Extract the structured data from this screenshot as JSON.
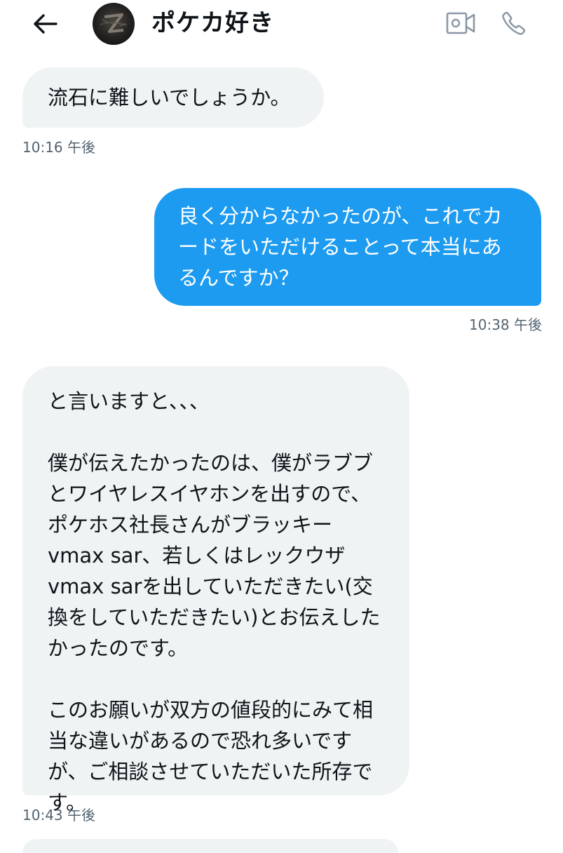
{
  "header": {
    "title": "ポケカ好き",
    "icons": {
      "back": "back-arrow-icon",
      "avatar": "avatar",
      "video": "video-call-icon",
      "phone": "phone-icon"
    }
  },
  "messages": [
    {
      "direction": "received",
      "text": "流石に難しいでしょうか。",
      "time": "10:16 午後"
    },
    {
      "direction": "sent",
      "text": "良く分からなかったのが、これでカードをいただけることって本当にあるんですか？",
      "time": "10:38 午後"
    },
    {
      "direction": "received",
      "text": "と言いますと、、、\n\n僕が伝えたかったのは、僕がラブブとワイヤレスイヤホンを出すので、ポケホス社長さんがブラッキーvmax sar、若しくはレックウザvmax sarを出していただきたい(交換をしていただきたい)とお伝えしたかったのです。\n\nこのお願いが双方の値段的にみて相当な違いがあるので恐れ多いですが、ご相談させていただいた所存です。",
      "time": "10:43 午後"
    }
  ],
  "colors": {
    "sent_bubble": "#1d9bf0",
    "received_bubble": "#eff3f4",
    "timestamp": "#536471",
    "text": "#0f1419",
    "icon_gray": "#8b98a5"
  }
}
